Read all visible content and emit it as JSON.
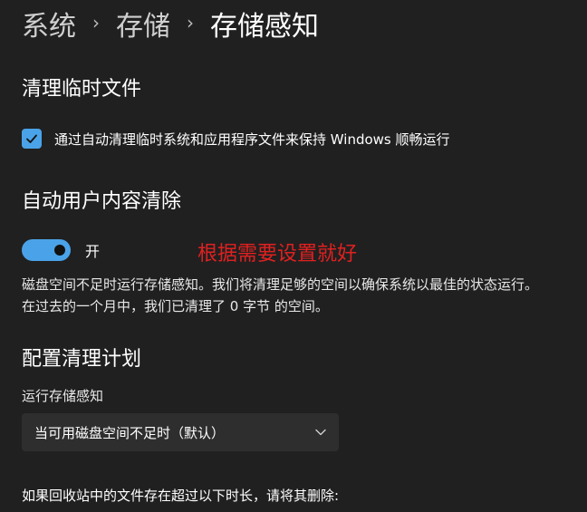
{
  "breadcrumb": {
    "items": [
      "系统",
      "存储",
      "存储感知"
    ],
    "separator": "›"
  },
  "temp_files": {
    "title": "清理临时文件",
    "checkbox_label": "通过自动清理临时系统和应用程序文件来保持 Windows 顺畅运行",
    "checked": true
  },
  "user_content": {
    "title": "自动用户内容清除",
    "toggle_label": "开",
    "toggle_on": true,
    "annotation": "根据需要设置就好",
    "description": "磁盘空间不足时运行存储感知。我们将清理足够的空间以确保系统以最佳的状态运行。 在过去的一个月中，我们已清理了 0 字节 的空间。"
  },
  "schedule": {
    "title": "配置清理计划",
    "run_label": "运行存储感知",
    "run_value": "当可用磁盘空间不足时（默认）",
    "recycle_bin_text": "如果回收站中的文件存在超过以下时长，请将其删除:"
  },
  "colors": {
    "background": "#202020",
    "accent": "#4aa3e8",
    "annotation": "#e02020"
  }
}
